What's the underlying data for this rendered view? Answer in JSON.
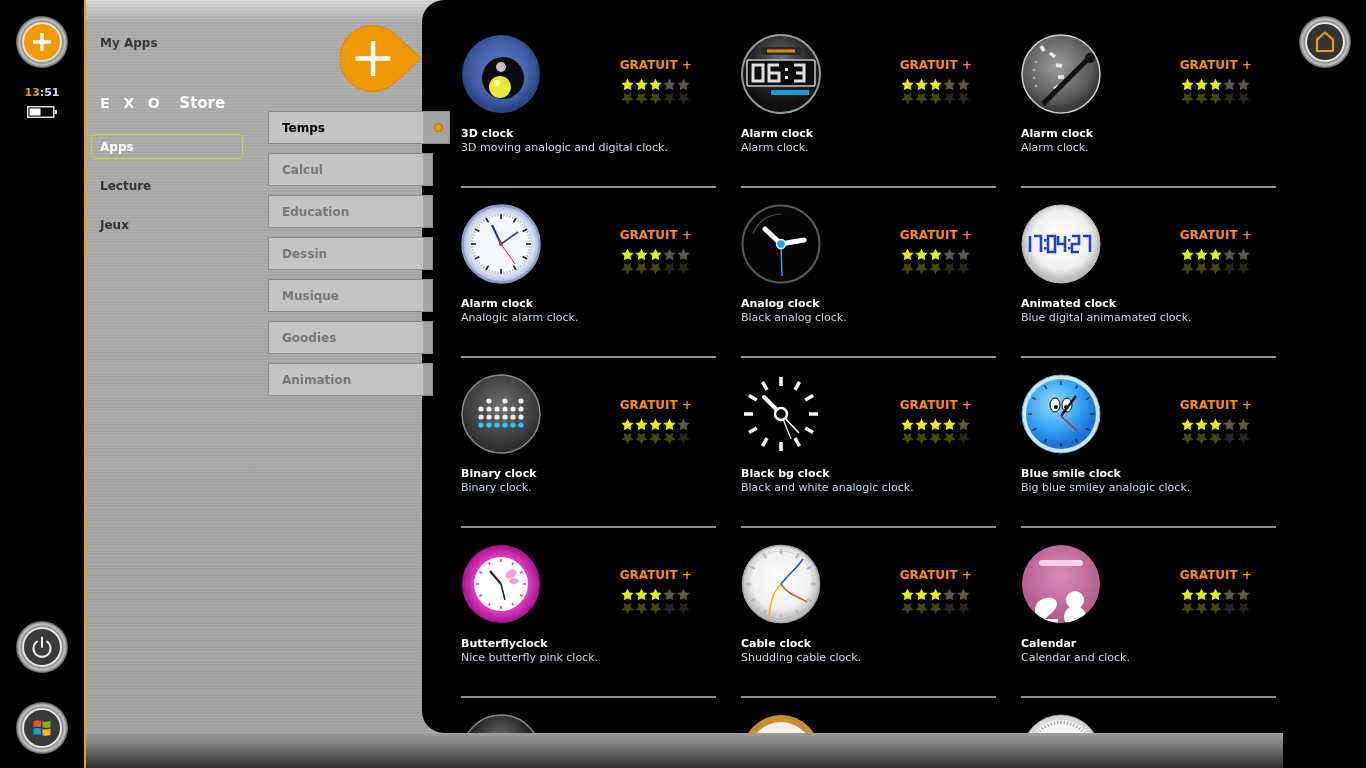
{
  "dock": {
    "clock": {
      "hours": "13",
      "separator": ":",
      "minutes": "51"
    }
  },
  "sidebar": {
    "my_apps": "My Apps",
    "logo": {
      "mark": "EXO",
      "name": "Store"
    },
    "nav": [
      {
        "label": "Apps",
        "selected": true
      },
      {
        "label": "Lecture",
        "selected": false
      },
      {
        "label": "Jeux",
        "selected": false
      }
    ]
  },
  "categories": [
    {
      "label": "Temps",
      "selected": true
    },
    {
      "label": "Calcul",
      "selected": false
    },
    {
      "label": "Education",
      "selected": false
    },
    {
      "label": "Dessin",
      "selected": false
    },
    {
      "label": "Musique",
      "selected": false
    },
    {
      "label": "Goodies",
      "selected": false
    },
    {
      "label": "Animation",
      "selected": false
    }
  ],
  "apps": [
    {
      "name": "3D clock",
      "description": "3D moving analogic and digital clock.",
      "price": "GRATUIT +",
      "stars": 3
    },
    {
      "name": "Alarm clock",
      "description": "Alarm clock.",
      "price": "GRATUIT +",
      "stars": 3
    },
    {
      "name": "Alarm clock",
      "description": "Alarm clock.",
      "price": "GRATUIT +",
      "stars": 3
    },
    {
      "name": "Alarm clock",
      "description": "Analogic alarm clock.",
      "price": "GRATUIT +",
      "stars": 3
    },
    {
      "name": "Analog clock",
      "description": "Black analog clock.",
      "price": "GRATUIT +",
      "stars": 3
    },
    {
      "name": "Animated clock",
      "description": "Blue digital animamated clock.",
      "price": "GRATUIT +",
      "stars": 3
    },
    {
      "name": "Binary clock",
      "description": "Binary clock.",
      "price": "GRATUIT +",
      "stars": 4
    },
    {
      "name": "Black bg clock",
      "description": "Black and white analogic clock.",
      "price": "GRATUIT +",
      "stars": 4
    },
    {
      "name": "Blue smile clock",
      "description": "Big blue smiley analogic clock.",
      "price": "GRATUIT +",
      "stars": 3
    },
    {
      "name": "Butterflyclock",
      "description": "Nice butterfly pink clock.",
      "price": "GRATUIT +",
      "stars": 3
    },
    {
      "name": "Cable clock",
      "description": "Shudding cable clock.",
      "price": "GRATUIT +",
      "stars": 3
    },
    {
      "name": "Calendar",
      "description": "Calendar and clock.",
      "price": "GRATUIT +",
      "stars": 3
    }
  ],
  "more_apps_below": true
}
